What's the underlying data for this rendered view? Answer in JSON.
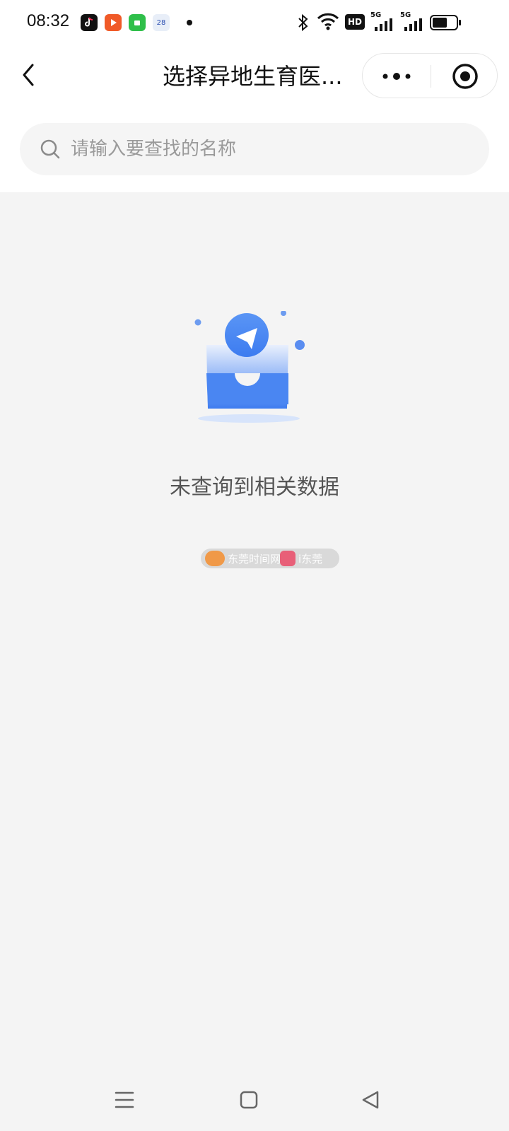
{
  "status_bar": {
    "time": "08:32",
    "apps": [
      {
        "icon": "tiktok-icon",
        "color": "#111111"
      },
      {
        "icon": "video-play-icon",
        "color": "#f05a28"
      },
      {
        "icon": "app-store-icon",
        "color": "#2fbf4a"
      },
      {
        "icon": "calendar-icon",
        "color": "#e8eef8",
        "text": "28"
      }
    ],
    "indicators": [
      "bluetooth-icon",
      "wifi-icon",
      "hd-icon",
      "signal-5g-icon",
      "signal-5g-icon",
      "battery-icon"
    ],
    "hd_label": "HD",
    "net_label": "5G"
  },
  "nav": {
    "title": "选择异地生育医...",
    "back_icon": "chevron-left-icon",
    "more_icon": "more-dots-icon",
    "close_icon": "target-close-icon"
  },
  "search": {
    "placeholder": "请输入要查找的名称",
    "value": ""
  },
  "empty_state": {
    "message": "未查询到相关数据",
    "illustration": "empty-inbox-illustration"
  },
  "watermark": {
    "brand1": "东莞时间网",
    "brand2": "i东莞"
  },
  "colors": {
    "accent_blue": "#3d7cf0",
    "background": "#f4f4f4"
  },
  "bottom_nav": [
    "menu-icon",
    "home-icon",
    "back-icon"
  ]
}
